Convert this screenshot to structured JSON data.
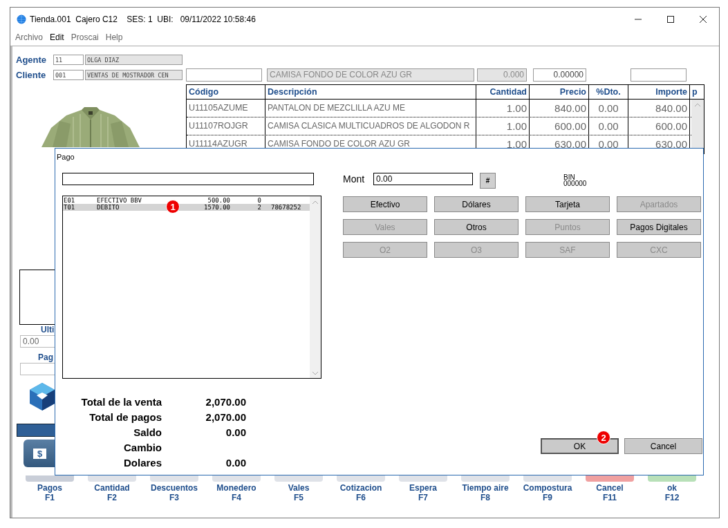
{
  "window": {
    "title": "Tienda.001  Cajero C12    SES: 1  UBI:   09/11/2022 10:58:46"
  },
  "menu": [
    {
      "label": "Archivo",
      "disabled": true
    },
    {
      "label": "Edit",
      "disabled": false
    },
    {
      "label": "Proscai",
      "disabled": true
    },
    {
      "label": "Help",
      "disabled": true
    }
  ],
  "agent": {
    "label": "Agente",
    "code": "11",
    "name": "OLGA DIAZ"
  },
  "client": {
    "label": "Cliente",
    "code": "001",
    "name": "VENTAS DE MOSTRADOR CEN"
  },
  "item_entry": {
    "description": "CAMISA FONDO DE COLOR AZU GR",
    "quantity": "0.000",
    "price": "0.00000"
  },
  "table": {
    "columns": [
      "Código",
      "Descripción",
      "Cantidad",
      "Precio",
      "%Dto.",
      "Importe",
      "p"
    ],
    "rows": [
      {
        "cells": [
          "U11105AZUME",
          "PANTALON DE MEZCLILLA AZU ME",
          "1.00",
          "840.00",
          "0.00",
          "840.00"
        ]
      },
      {
        "cells": [
          "U11107ROJGR",
          "CAMISA CLASICA MULTICUADROS DE ALGODON R",
          "1.00",
          "600.00",
          "0.00",
          "600.00"
        ]
      },
      {
        "cells": [
          "U11114AZUGR",
          "CAMISA FONDO DE COLOR AZU GR",
          "1.00",
          "630.00",
          "0.00",
          "630.00"
        ]
      }
    ]
  },
  "left_panel": {
    "last_label": "Ulti",
    "last_value": "0.00",
    "pay_label": "Pag",
    "cash_button": "$"
  },
  "function_keys": [
    {
      "label": "Pagos",
      "key": "F1",
      "color": "#c9ced8"
    },
    {
      "label": "Cantidad",
      "key": "F2",
      "color": "#dfe2e8"
    },
    {
      "label": "Descuentos",
      "key": "F3",
      "color": "#dfe2e8"
    },
    {
      "label": "Monedero",
      "key": "F4",
      "color": "#dfe2e8"
    },
    {
      "label": "Vales",
      "key": "F5",
      "color": "#dfe2e8"
    },
    {
      "label": "Cotizacion",
      "key": "F6",
      "color": "#dfe2e8"
    },
    {
      "label": "Espera",
      "key": "F7",
      "color": "#dfe2e8"
    },
    {
      "label": "Tiempo aire",
      "key": "F8",
      "color": "#dfe2e8"
    },
    {
      "label": "Compostura",
      "key": "F9",
      "color": "#dfe2e8"
    },
    {
      "label": "Cancel",
      "key": "F11",
      "color": "#f0a0a0"
    },
    {
      "label": "ok",
      "key": "F12",
      "color": "#b8e0b8"
    }
  ],
  "dialog": {
    "title": "Pago",
    "mont_label": "Mont",
    "mont_value": "0.00",
    "hash_button": "#",
    "bin_label": "BIN",
    "bin_value": "000000",
    "payments": [
      {
        "code": "E01",
        "name": "EFECTIVO BBV",
        "amount": "500.00",
        "qty": "0",
        "selected": false
      },
      {
        "code": "T01",
        "name": "DEBITO",
        "amount": "1570.00",
        "qty": "2",
        "ref": "78678252",
        "selected": true
      }
    ],
    "buttons": [
      {
        "label": "Efectivo",
        "disabled": false
      },
      {
        "label": "Dólares",
        "disabled": false
      },
      {
        "label": "Tarjeta",
        "disabled": false
      },
      {
        "label": "Apartados",
        "disabled": true
      },
      {
        "label": "Vales",
        "disabled": true
      },
      {
        "label": "Otros",
        "disabled": false
      },
      {
        "label": "Puntos",
        "disabled": true
      },
      {
        "label": "Pagos Digitales",
        "disabled": false
      },
      {
        "label": "O2",
        "disabled": true
      },
      {
        "label": "O3",
        "disabled": true
      },
      {
        "label": "SAF",
        "disabled": true
      },
      {
        "label": "CXC",
        "disabled": true
      }
    ],
    "totals": [
      {
        "label": "Total de la venta",
        "value": "2,070.00"
      },
      {
        "label": "Total de pagos",
        "value": "2,070.00"
      },
      {
        "label": "Saldo",
        "value": "0.00"
      },
      {
        "label": "Cambio"
      },
      {
        "label": "Dolares",
        "value": "0.00"
      }
    ],
    "ok_button": "OK",
    "cancel_button": "Cancel",
    "callouts": [
      "1",
      "2"
    ]
  }
}
